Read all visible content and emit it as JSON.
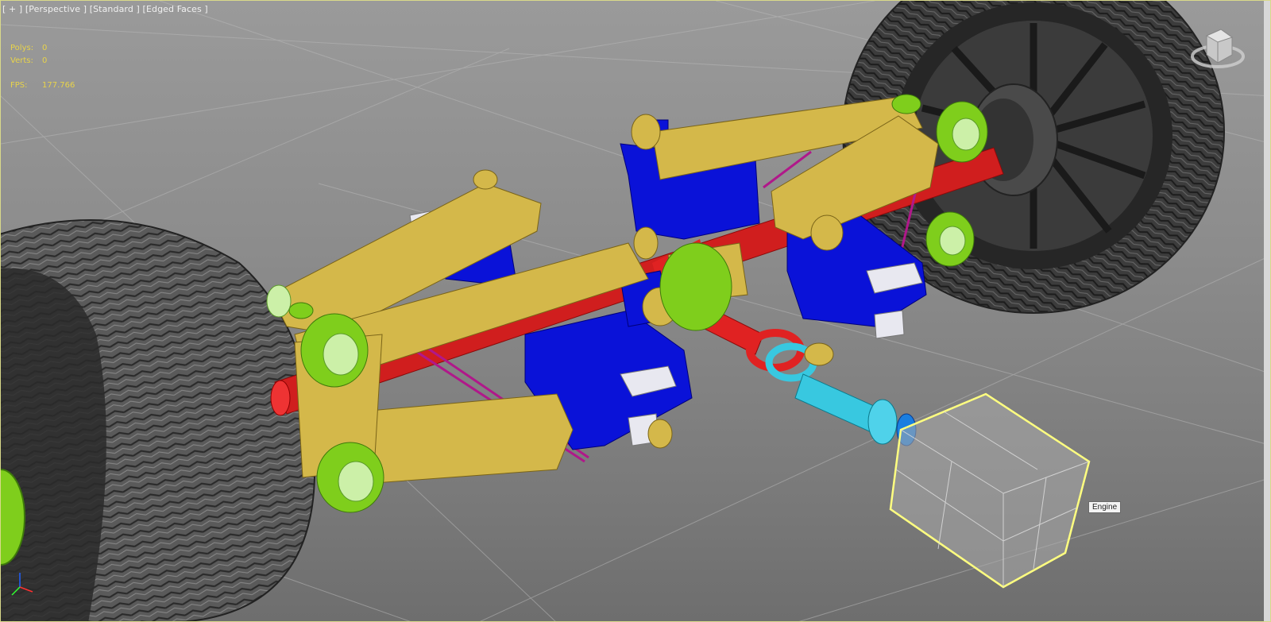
{
  "viewport": {
    "label_plus": "[ + ]",
    "label_view": "[Perspective ]",
    "label_shading": "[Standard ]",
    "label_edged": "[Edged Faces ]"
  },
  "stats": {
    "polys_label": "Polys:",
    "polys_value": "0",
    "verts_label": "Verts:",
    "verts_value": "0",
    "fps_label": "FPS:",
    "fps_value": "177.766"
  },
  "tooltip": {
    "engine_label": "Engine"
  },
  "colors": {
    "arm_yellow": "#d4b84a",
    "mount_blue": "#0a12d8",
    "axle_red": "#e02222",
    "bushing_green": "#7fce1c",
    "driveshaft_cyan": "#38c8e0",
    "tie_rod_magenta": "#b0188a",
    "selection_yellow": "#ffff80"
  }
}
